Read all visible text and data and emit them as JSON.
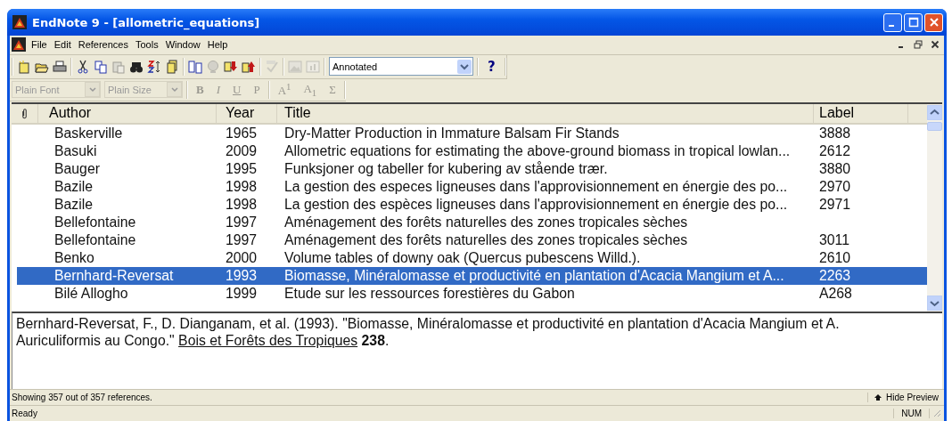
{
  "window": {
    "title": "EndNote 9 - [allometric_equations]"
  },
  "menu": {
    "items": [
      "File",
      "Edit",
      "References",
      "Tools",
      "Window",
      "Help"
    ]
  },
  "toolbar": {
    "groups": [
      [
        {
          "kind": "new",
          "disabled": false
        },
        {
          "kind": "open",
          "disabled": false
        },
        {
          "kind": "print",
          "disabled": false
        }
      ],
      [
        {
          "kind": "cut",
          "disabled": false
        },
        {
          "kind": "copy",
          "disabled": false
        },
        {
          "kind": "paste",
          "disabled": true
        },
        {
          "kind": "find",
          "disabled": false
        },
        {
          "kind": "sort",
          "disabled": false
        },
        {
          "kind": "page",
          "disabled": false
        }
      ],
      [
        {
          "kind": "columns",
          "disabled": false
        },
        {
          "kind": "globe",
          "disabled": true
        },
        {
          "kind": "down",
          "disabled": false
        },
        {
          "kind": "up",
          "disabled": false
        }
      ],
      [
        {
          "kind": "spell",
          "disabled": true
        }
      ],
      [
        {
          "kind": "image",
          "disabled": true
        },
        {
          "kind": "chart",
          "disabled": true
        }
      ]
    ],
    "style_select": {
      "value": "Annotated"
    },
    "help": "?"
  },
  "format_bar": {
    "font": {
      "value": "Plain Font",
      "disabled": true
    },
    "size": {
      "value": "Plain Size",
      "disabled": true
    },
    "buttons": [
      {
        "label": "B",
        "kind": "bold",
        "disabled": true
      },
      {
        "label": "I",
        "kind": "italic",
        "disabled": true
      },
      {
        "label": "U",
        "kind": "underline",
        "disabled": true
      },
      {
        "label": "P",
        "kind": "plain",
        "disabled": true
      },
      {
        "label": "A$^{1}$",
        "kind": "sup",
        "disabled": true
      },
      {
        "label": "A$_{1}$",
        "kind": "sub",
        "disabled": true
      },
      {
        "label": "Σ",
        "kind": "symbol",
        "disabled": true
      }
    ]
  },
  "table": {
    "columns": [
      "Author",
      "Year",
      "Title",
      "Label"
    ],
    "rows": [
      {
        "author": "Baskerville",
        "year": "1965",
        "title": "Dry-Matter Production in Immature Balsam Fir Stands",
        "label": "3888",
        "selected": false
      },
      {
        "author": "Basuki",
        "year": "2009",
        "title": "Allometric equations for estimating the above-ground biomass in tropical lowlan...",
        "label": "2612",
        "selected": false
      },
      {
        "author": "Bauger",
        "year": "1995",
        "title": "Funksjoner og tabeller for kubering av stående trær.",
        "label": "3880",
        "selected": false
      },
      {
        "author": "Bazile",
        "year": "1998",
        "title": "La gestion des especes ligneuses dans l'approvisionnement en énergie des po...",
        "label": "2970",
        "selected": false
      },
      {
        "author": "Bazile",
        "year": "1998",
        "title": "La gestion des espèces ligneuses dans l'approvisionnement en énergie des po...",
        "label": "2971",
        "selected": false
      },
      {
        "author": "Bellefontaine",
        "year": "1997",
        "title": "Aménagement des forêts naturelles des zones tropicales sèches",
        "selected": false
      },
      {
        "author": "Bellefontaine",
        "year": "1997",
        "title": "Aménagement des forêts naturelles des zones tropicales sèches",
        "label": "3011",
        "selected": false
      },
      {
        "author": "Benko",
        "year": "2000",
        "title": "Volume tables of downy oak (Quercus pubescens Willd.).",
        "label": "2610",
        "selected": false
      },
      {
        "author": "Bernhard-Reversat",
        "year": "1993",
        "title": "Biomasse, Minéralomasse et productivité en plantation d'Acacia Mangium et A...",
        "label": "2263",
        "selected": true
      },
      {
        "author": "Bilé Allogho",
        "year": "1999",
        "title": "Etude sur les ressources forestières du Gabon",
        "label": "A268",
        "selected": false
      }
    ]
  },
  "preview": {
    "text": "Bernhard-Reversat, F., D. Dianganam, et al. (1993). \"Biomasse, Minéralomasse et productivité en plantation d'Acacia Mangium et A. Auriculiformis au Congo.\" ",
    "journal": "Bois et Forêts des Tropiques",
    "volume": "238",
    "end": "."
  },
  "status_bar": {
    "count": "Showing 357 out of 357 references.",
    "toggle": "Hide Preview",
    "state": "Ready",
    "num": "NUM"
  }
}
